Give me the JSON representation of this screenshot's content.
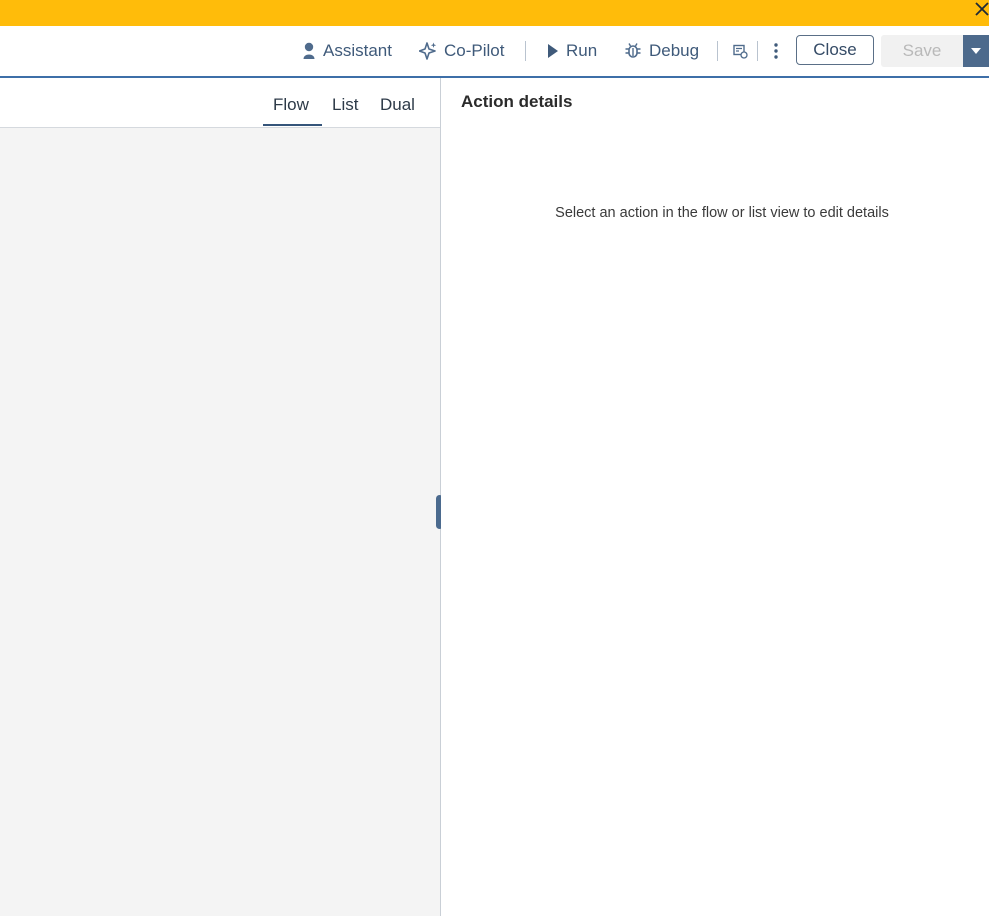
{
  "toolbar": {
    "assistant_label": "Assistant",
    "copilot_label": "Co-Pilot",
    "run_label": "Run",
    "debug_label": "Debug",
    "close_label": "Close",
    "save_label": "Save"
  },
  "view_tabs": {
    "flow": "Flow",
    "list": "List",
    "dual": "Dual",
    "active": "Flow"
  },
  "details_panel": {
    "title": "Action details",
    "empty_message": "Select an action in the flow or list view to edit details"
  },
  "colors": {
    "banner": "#ffbc0a",
    "accent": "#3e6fa8",
    "toolbar_text": "#3f5a7a",
    "save_dropdown": "#4d6a8c"
  },
  "icons": [
    "close-icon",
    "assistant-icon",
    "copilot-sparkle-icon",
    "run-play-icon",
    "debug-bug-icon",
    "variables-icon",
    "more-vertical-icon",
    "chevron-down-icon"
  ]
}
